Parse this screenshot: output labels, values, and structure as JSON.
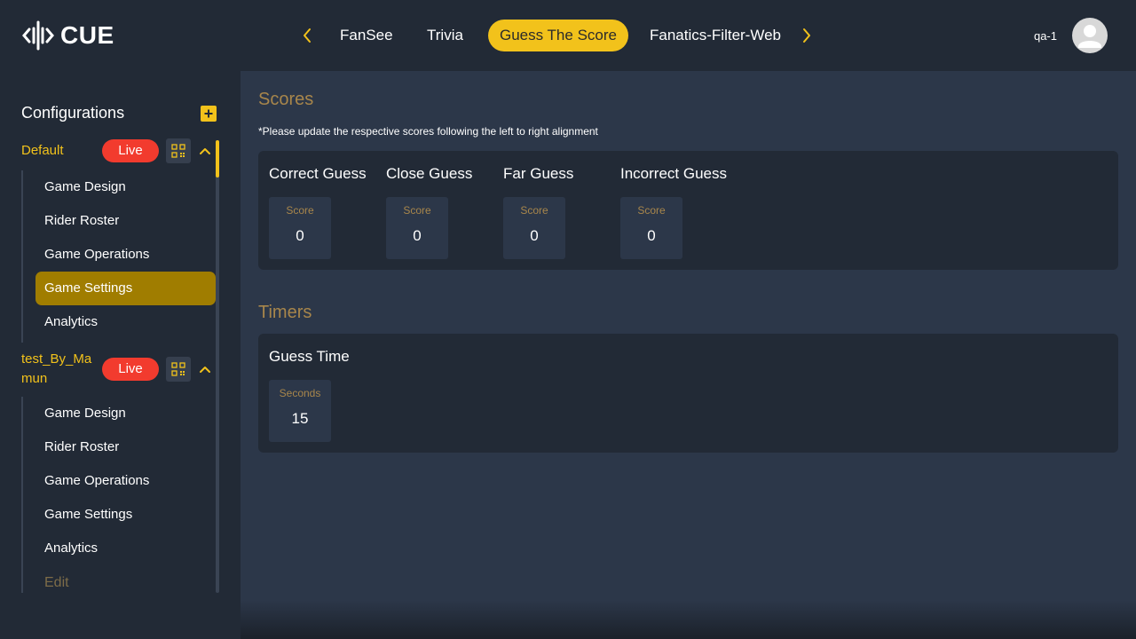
{
  "app": {
    "logo_text": "CUE"
  },
  "nav": {
    "tabs": [
      {
        "label": "FanSee",
        "active": false
      },
      {
        "label": "Trivia",
        "active": false
      },
      {
        "label": "Guess The Score",
        "active": true
      },
      {
        "label": "Fanatics-Filter-Web",
        "active": false
      }
    ]
  },
  "user": {
    "name": "qa-1"
  },
  "sidebar": {
    "title": "Configurations",
    "configs": [
      {
        "name": "Default",
        "badge": "Live",
        "items": [
          {
            "label": "Game Design",
            "active": false
          },
          {
            "label": "Rider Roster",
            "active": false
          },
          {
            "label": "Game Operations",
            "active": false
          },
          {
            "label": "Game Settings",
            "active": true
          },
          {
            "label": "Analytics",
            "active": false
          }
        ]
      },
      {
        "name_line1": "test_By_Ma",
        "name_line2": "mun",
        "badge": "Live",
        "items": [
          {
            "label": "Game Design",
            "active": false
          },
          {
            "label": "Rider Roster",
            "active": false
          },
          {
            "label": "Game Operations",
            "active": false
          },
          {
            "label": "Game Settings",
            "active": false
          },
          {
            "label": "Analytics",
            "active": false
          }
        ]
      }
    ],
    "edit_label": "Edit"
  },
  "scores": {
    "title": "Scores",
    "note": "*Please update the respective scores following the left to right alignment",
    "fields": [
      {
        "label": "Correct Guess",
        "caption": "Score",
        "value": "0"
      },
      {
        "label": "Close Guess",
        "caption": "Score",
        "value": "0"
      },
      {
        "label": "Far Guess",
        "caption": "Score",
        "value": "0"
      },
      {
        "label": "Incorrect Guess",
        "caption": "Score",
        "value": "0"
      }
    ]
  },
  "timers": {
    "title": "Timers",
    "fields": [
      {
        "label": "Guess Time",
        "caption": "Seconds",
        "value": "15"
      }
    ]
  },
  "colors": {
    "accent": "#f2c21b",
    "live": "#f23b2e",
    "section_title": "#a8864b",
    "active_item": "#a07d00"
  },
  "icons": {
    "logo": "waveform-logo-icon",
    "prev": "chevron-left-icon",
    "next": "chevron-right-icon",
    "avatar": "user-avatar-icon",
    "add": "plus-icon",
    "qr": "qr-code-icon",
    "collapse": "chevron-up-icon"
  }
}
